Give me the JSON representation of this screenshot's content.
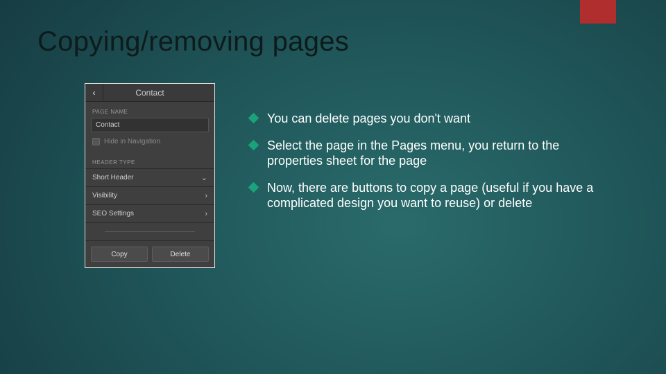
{
  "accent_color": "#b02e2e",
  "title": "Copying/removing pages",
  "panel": {
    "header_title": "Contact",
    "page_name_label": "PAGE NAME",
    "page_name_value": "Contact",
    "hide_nav_label": "Hide in Navigation",
    "header_type_label": "HEADER TYPE",
    "rows": {
      "short_header": "Short Header",
      "visibility": "Visibility",
      "seo": "SEO Settings"
    },
    "copy_btn": "Copy",
    "delete_btn": "Delete"
  },
  "bullets": [
    "You can delete pages you don't want",
    "Select the page in the Pages menu, you return to the properties sheet for the page",
    "Now, there are buttons to copy a page (useful if you have a complicated design you want to reuse) or delete"
  ]
}
